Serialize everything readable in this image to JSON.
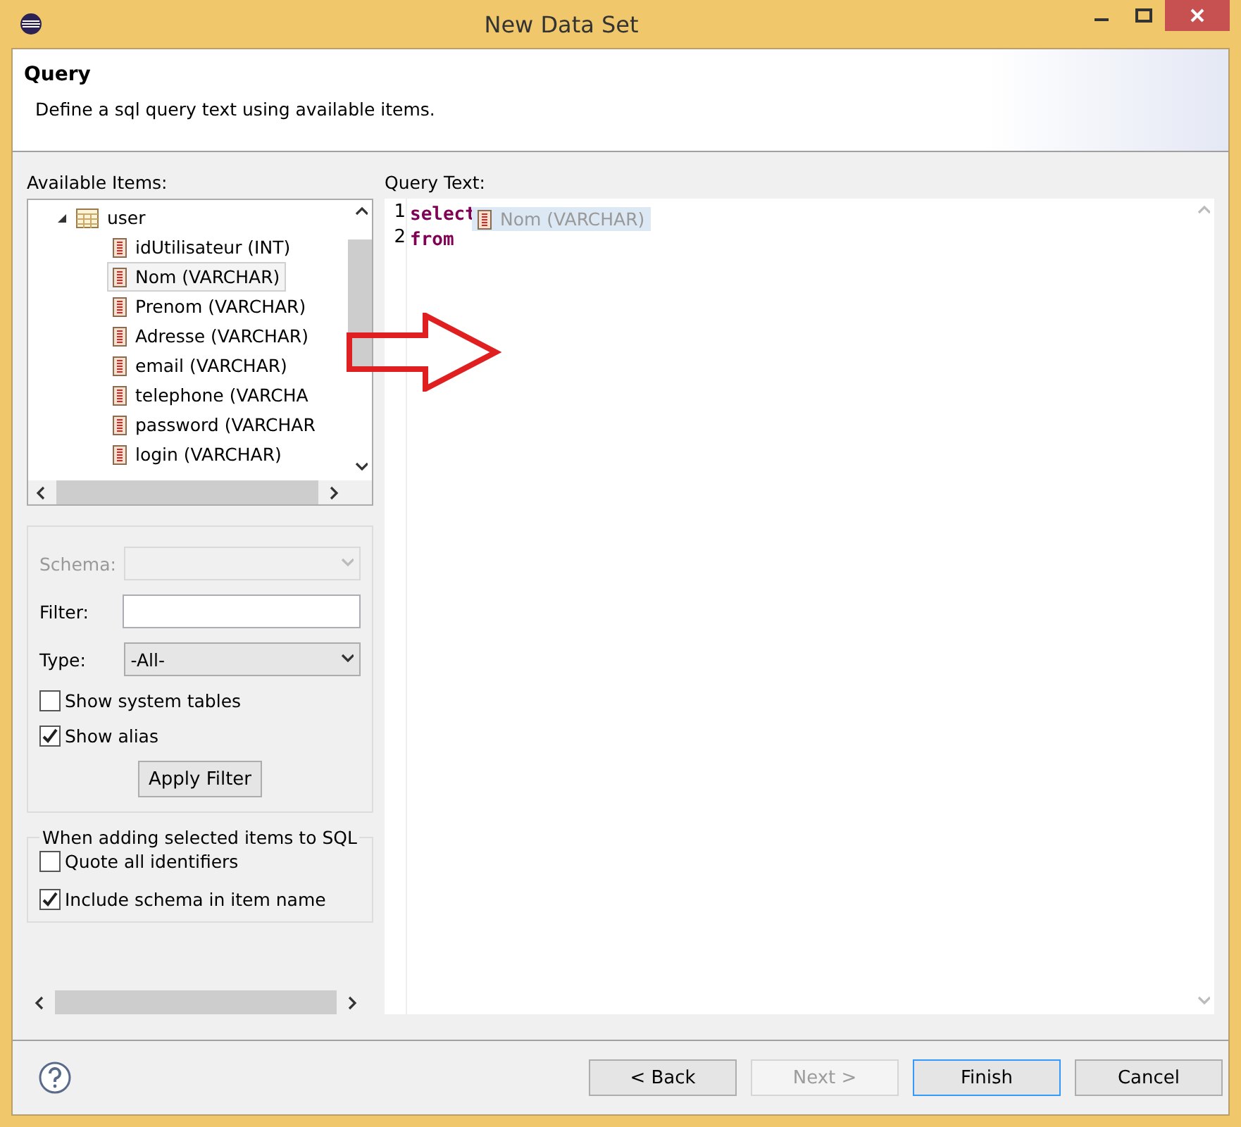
{
  "window": {
    "title": "New Data Set"
  },
  "header": {
    "title": "Query",
    "description": "Define a sql query text using available items."
  },
  "available_items": {
    "label": "Available Items:",
    "tree": [
      {
        "label": "user",
        "expanded": true,
        "children": [
          {
            "label": "idUtilisateur (INT)",
            "selected": false
          },
          {
            "label": "Nom (VARCHAR)",
            "selected": true
          },
          {
            "label": "Prenom (VARCHAR)",
            "selected": false
          },
          {
            "label": "Adresse (VARCHAR)",
            "selected": false
          },
          {
            "label": "email (VARCHAR)",
            "selected": false
          },
          {
            "label": "telephone (VARCHA",
            "selected": false
          },
          {
            "label": "password (VARCHAR",
            "selected": false
          },
          {
            "label": "login (VARCHAR)",
            "selected": false
          }
        ]
      }
    ]
  },
  "filter": {
    "schema_label": "Schema:",
    "schema_disabled": true,
    "filter_label": "Filter:",
    "type_label": "Type:",
    "type_value": "-All-",
    "checkboxes": [
      {
        "label": "Show system tables",
        "checked": false
      },
      {
        "label": "Show alias",
        "checked": true
      }
    ],
    "apply_button": "Apply Filter"
  },
  "sql_options": {
    "title": "When adding selected items to SQL",
    "checkboxes": [
      {
        "label": "Quote all identifiers",
        "checked": false
      },
      {
        "label": "Include schema in item name",
        "checked": true
      }
    ]
  },
  "query": {
    "label": "Query Text:",
    "lines": [
      {
        "number": "1",
        "text": "select"
      },
      {
        "number": "2",
        "text": "from"
      }
    ],
    "suggestion": "Nom (VARCHAR)"
  },
  "buttons": [
    {
      "label": "< Back",
      "disabled": false,
      "default": false
    },
    {
      "label": "Next >",
      "disabled": true,
      "default": false
    },
    {
      "label": "Finish",
      "disabled": false,
      "default": true
    },
    {
      "label": "Cancel",
      "disabled": false,
      "default": false
    }
  ]
}
